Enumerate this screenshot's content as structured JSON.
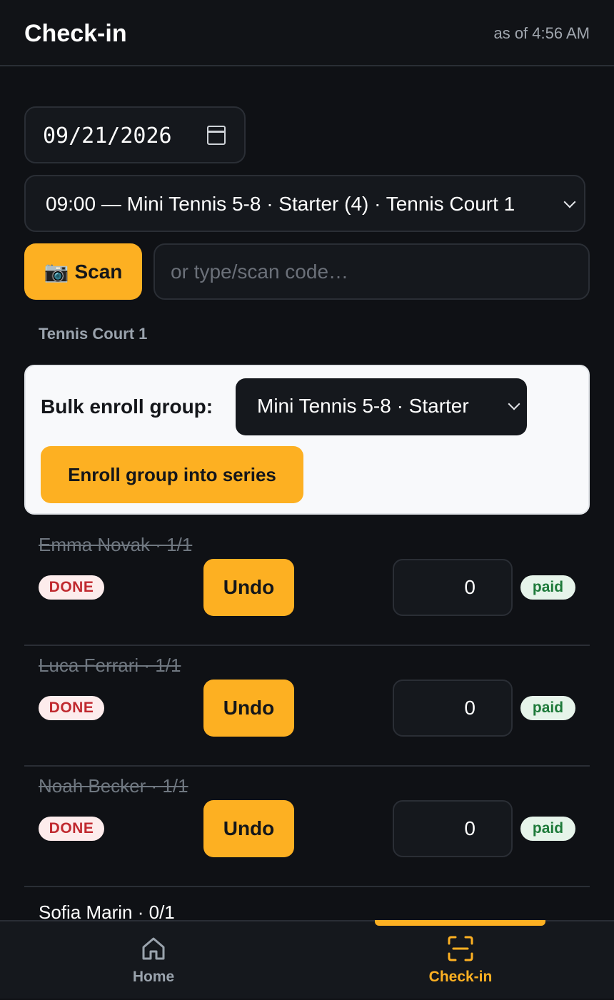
{
  "header": {
    "title": "Check-in",
    "as_of": "as of 4:56 AM"
  },
  "filters": {
    "date_value": "09/21/2026",
    "session_value": "09:00 — Mini Tennis 5-8 · Starter (4) · Tennis Court 1"
  },
  "scan": {
    "button_label": "Scan",
    "button_icon": "camera-icon",
    "code_placeholder": "or type/scan code…"
  },
  "court_label": "Tennis Court 1",
  "bulk": {
    "label": "Bulk enroll group:",
    "group_value": "Mini Tennis 5-8 · Starter",
    "enroll_button": "Enroll group into series"
  },
  "attendees": [
    {
      "name": "Emma Novak · 1/1",
      "status": "DONE",
      "action": "Undo",
      "amount": "0",
      "payment": "paid"
    },
    {
      "name": "Luca Ferrari · 1/1",
      "status": "DONE",
      "action": "Undo",
      "amount": "0",
      "payment": "paid"
    },
    {
      "name": "Noah Becker · 1/1",
      "status": "DONE",
      "action": "Undo",
      "amount": "0",
      "payment": "paid"
    },
    {
      "name": "Sofia Marin · 0/1"
    }
  ],
  "bottom_nav": {
    "items": [
      {
        "label": "Home",
        "icon": "home-icon",
        "active": false
      },
      {
        "label": "Check-in",
        "icon": "scan-icon",
        "active": true
      }
    ]
  },
  "colors": {
    "accent": "#fdb022",
    "background": "#0f1115",
    "done_text": "#c0292f",
    "paid_text": "#1e7a3a"
  }
}
